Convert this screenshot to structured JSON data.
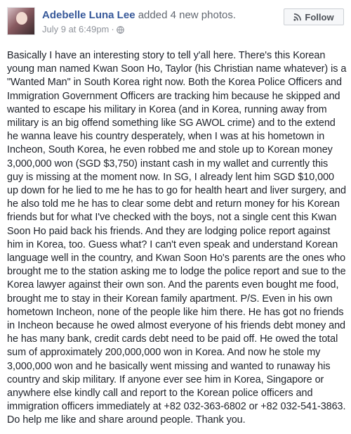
{
  "post": {
    "author": "Adebelle Luna Lee",
    "action": " added 4 new photos.",
    "date": "July 9 at 6:49pm",
    "dot": "·",
    "privacy_icon": "globe-icon",
    "follow_label": "Follow",
    "follow_icon": "rss-follow-icon",
    "text": "Basically I have an interesting story to tell y'all here. There's this Korean young man named Kwan Soon Ho, Taylor (his Christian name whatever) is a \"Wanted Man\" in South Korea right now. Both the Korea Police Officers and Immigration Government Officers are tracking him because he skipped and wanted to escape his military in Korea (and in Korea, running away from military is an big offend something like SG AWOL crime) and to the extend he wanna leave his country desperately, when I was at his hometown in Incheon, South Korea, he even robbed me and stole up to Korean money 3,000,000 won (SGD $3,750) instant cash in my wallet and currently this guy is missing at the moment now. In SG, I already lent him SGD $10,000 up down for he lied to me he has to go for health heart and liver surgery, and he also told me he has to clear some debt and return money for his Korean friends but for what I've checked with the boys, not a single cent this Kwan Soon Ho paid back his friends. And they are lodging police report against him in Korea, too. Guess what? I can't even speak and understand Korean language well in the country, and Kwan Soon Ho's parents are the ones who brought me to the station asking me to lodge the police report and sue to the Korea lawyer against their own son. And the parents even bought me food, brought me to stay in their Korean family apartment. P/S. Even in his own hometown Incheon, none of the people like him there. He has got no friends in Incheon because he owed almost everyone of his friends debt money and he has many bank, credit cards debt need to be paid off. He owed the total sum of approximately 200,000,000 won in Korea. And now he stole my 3,000,000 won and he basically went missing and wanted to runaway his country and skip military. If anyone ever see him in Korea, Singapore or anywhere else kindly call and report to the Korean police officers and immigration officers immediately at +82 032-363-6802 or +82 032-541-3863. Do help me like and share around people. Thank you."
  }
}
